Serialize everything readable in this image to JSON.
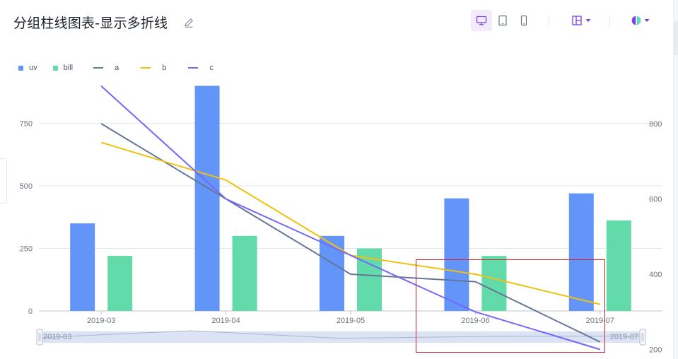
{
  "header": {
    "title": "分组柱线图表-显示多折线"
  },
  "colors": {
    "accent": "#7b3fe4",
    "highlight_box": "#d61f2c"
  },
  "toolbar": {
    "icons": [
      "desktop-icon",
      "tablet-icon",
      "mobile-icon",
      "layout-icon",
      "theme-icon"
    ]
  },
  "chart_data": {
    "type": "bar",
    "categories": [
      "2019-03",
      "2019-04",
      "2019-05",
      "2019-06",
      "2019-07"
    ],
    "left_axis": {
      "ticks": [
        "0",
        "250",
        "500",
        "750"
      ],
      "ylim": [
        0,
        900
      ]
    },
    "right_axis": {
      "ticks": [
        "200",
        "400",
        "600",
        "800"
      ],
      "ylim": [
        200,
        900
      ]
    },
    "bar_series": [
      {
        "name": "uv",
        "color": "#6395f9",
        "values": [
          350,
          900,
          300,
          450,
          470
        ]
      },
      {
        "name": "bill",
        "color": "#62daaa",
        "values": [
          220,
          300,
          250,
          220,
          362
        ]
      }
    ],
    "line_series": [
      {
        "name": "a",
        "color": "#657798",
        "values": [
          800,
          600,
          400,
          380,
          220
        ]
      },
      {
        "name": "b",
        "color": "#f0c20f",
        "values": [
          750,
          650,
          450,
          400,
          320
        ]
      },
      {
        "name": "c",
        "color": "#7666f9",
        "values": [
          900,
          600,
          450,
          300,
          200
        ]
      }
    ],
    "slider": {
      "start_label": "2019-03",
      "end_label": "2019-07"
    },
    "legend_position": "top-left",
    "grid": true
  }
}
